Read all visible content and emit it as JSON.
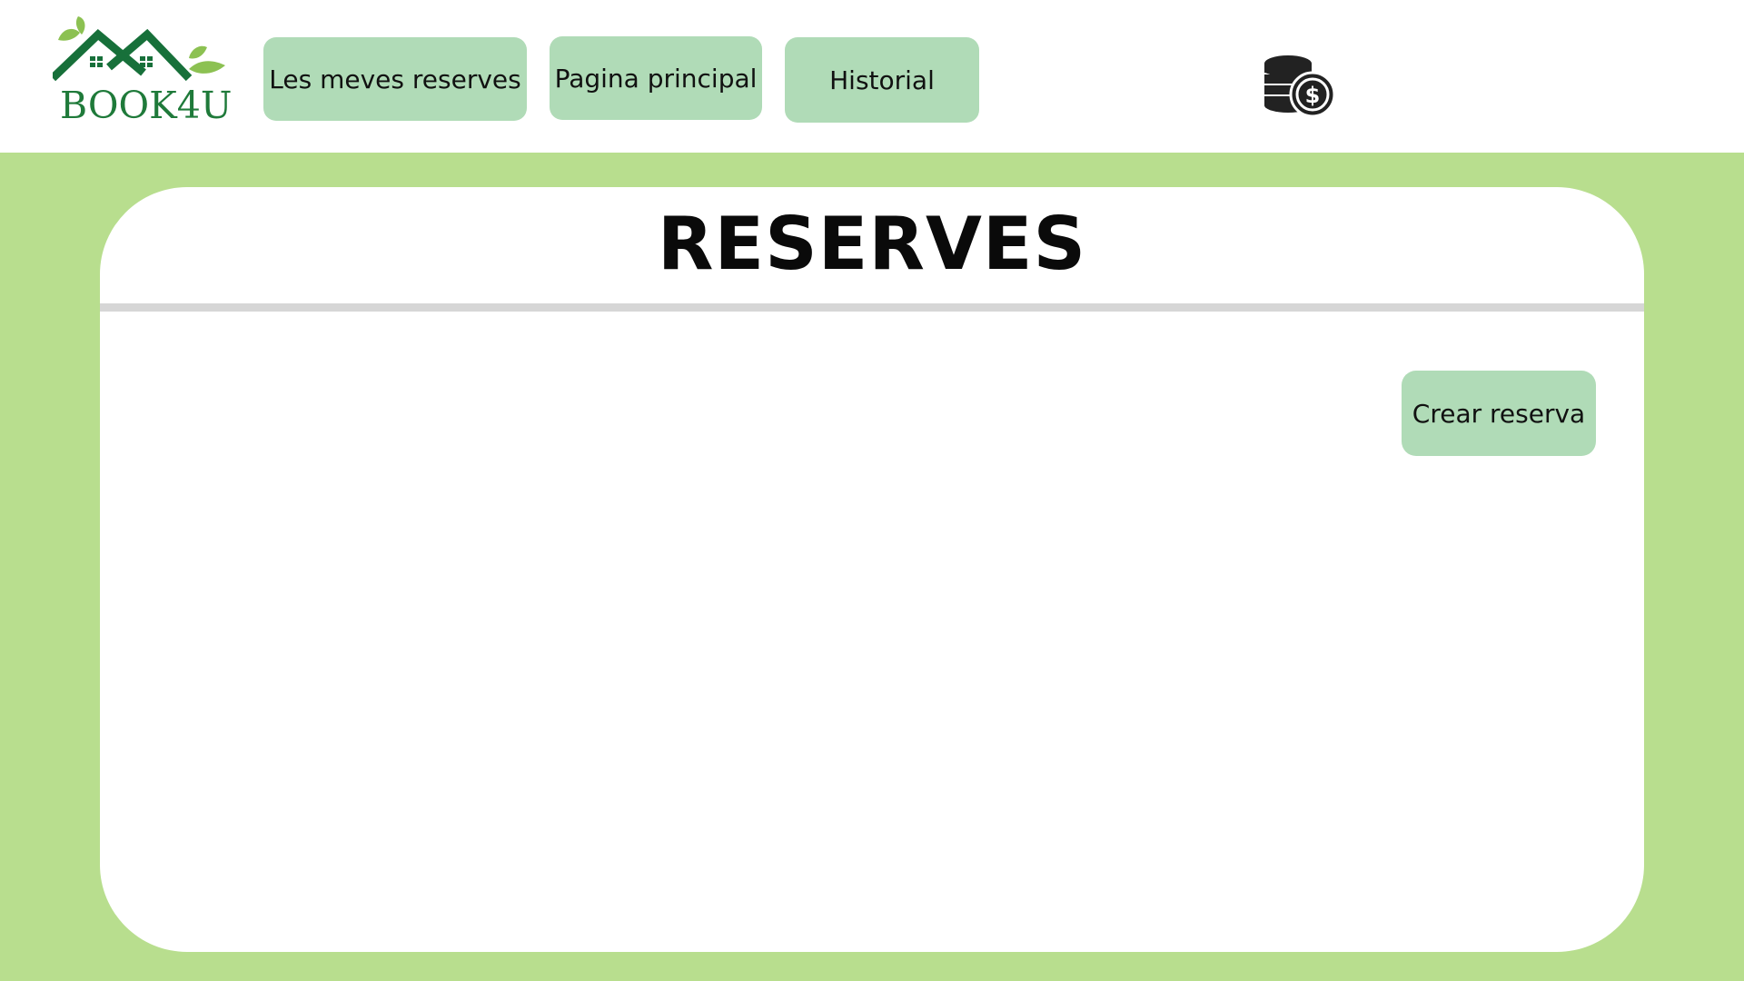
{
  "brand": {
    "name": "BOOK4U",
    "primary_color": "#1f7a3a",
    "leaf_color": "#8cc152"
  },
  "nav": {
    "items": [
      {
        "label": "Les meves reserves"
      },
      {
        "label": "Pagina principal"
      },
      {
        "label": "Historial"
      }
    ],
    "coins_icon": "coins-dollar-icon"
  },
  "main": {
    "title": "RESERVES",
    "create_button_label": "Crear reserva"
  },
  "colors": {
    "button_bg": "#b0dbb7",
    "page_bg": "#b8de8e",
    "panel_bg": "#ffffff",
    "divider": "#d6d6d6"
  }
}
